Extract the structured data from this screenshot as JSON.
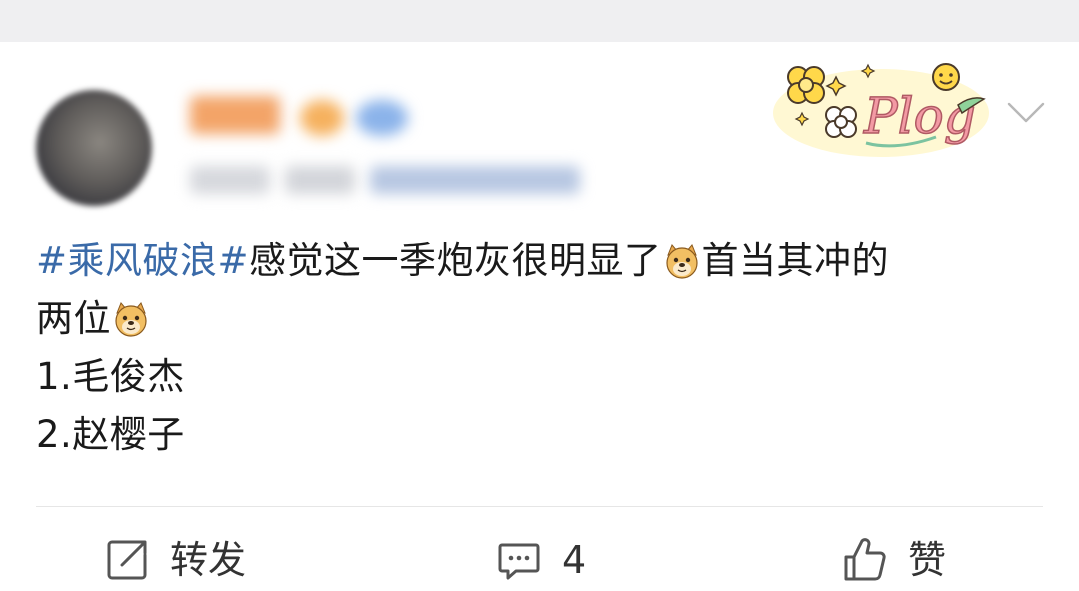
{
  "post": {
    "topic": "#乘风破浪#",
    "line1_text": "感觉这一季炮灰很明显了",
    "line1_tail": "首当其冲的",
    "line2_text": "两位",
    "item1": "1.毛俊杰",
    "item2": "2.赵樱子",
    "emoji": "doge"
  },
  "badge": {
    "text": "Plog"
  },
  "actions": {
    "repost_label": "转发",
    "comment_count": "4",
    "like_label": "赞"
  },
  "colors": {
    "topic": "#3a6aa8",
    "text": "#1a1a1a",
    "icon": "#555555",
    "background_strip": "#efeff1"
  }
}
